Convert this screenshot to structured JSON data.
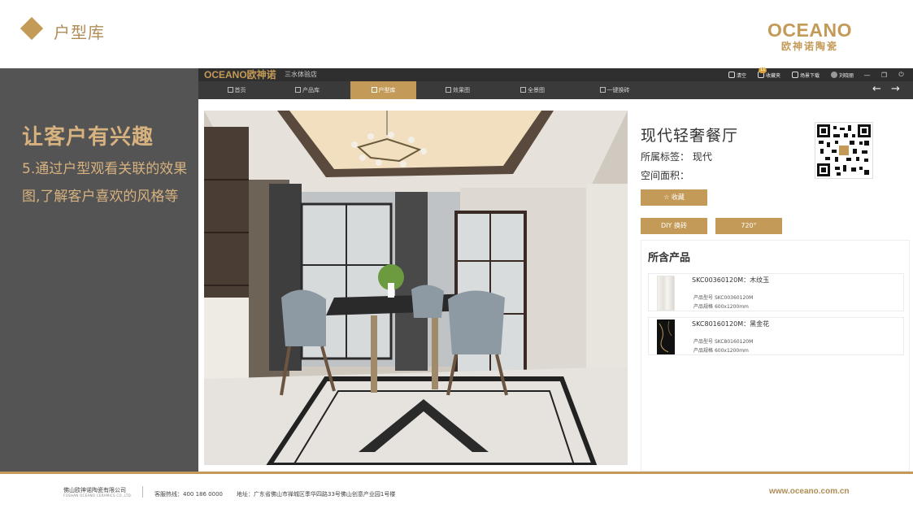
{
  "slide": {
    "title": "户型库",
    "brand_en": "OCEANO",
    "brand_cn": "欧神诺陶瓷"
  },
  "left_panel": {
    "heading": "让客户有兴趣",
    "description": "5.通过户型观看关联的效果图,了解客户喜欢的风格等"
  },
  "app": {
    "logo": "OCEANO欧神诺",
    "store_name": "三水体验店",
    "toolbar": {
      "clear": "清空",
      "favorites": "收藏夹",
      "favorites_badge": "11",
      "scene_download": "场景下载",
      "user": "刘晓丽"
    },
    "window_controls": {
      "minimize": "—",
      "restore": "❐",
      "power": "⏻"
    },
    "nav": {
      "tabs": [
        "首页",
        "产品库",
        "户型库",
        "效果图",
        "全景图",
        "一键换砖"
      ],
      "active_tab": "户型库",
      "back": "←",
      "forward": "→"
    },
    "detail": {
      "title": "现代轻奢餐厅",
      "tag_label": "所属标签：",
      "tag_value": "现代",
      "area_label": "空间面积：",
      "area_value": "",
      "favorite_button": "☆ 收藏",
      "diy_button": "DIY 换砖",
      "view720_button": "720°"
    },
    "products": {
      "title": "所含产品",
      "spec_model_label": "产品型号",
      "spec_size_label": "产品规格",
      "items": [
        {
          "name": "SKC00360120M：木纹玉",
          "model": "SKC00360120M",
          "size": "600x1200mm"
        },
        {
          "name": "SKC80160120M：黑金花",
          "model": "SKC80160120M",
          "size": "600x1200mm"
        }
      ]
    }
  },
  "footer": {
    "company": "佛山欧神诺陶瓷有限公司",
    "company_en": "FOSHAN OCEANO CERAMICS CO.,LTD.",
    "hotline": "客服热线：400 186 0000",
    "address": "地址：广东省佛山市禅城区季华四路33号佛山创意产业园1号楼",
    "website": "www.oceano.com.cn"
  },
  "colors": {
    "accent_gold": "#c39a57",
    "panel_gray": "#545454",
    "titlebar_dark": "#2f2f2f",
    "navbar_dark": "#3a3a3a"
  }
}
